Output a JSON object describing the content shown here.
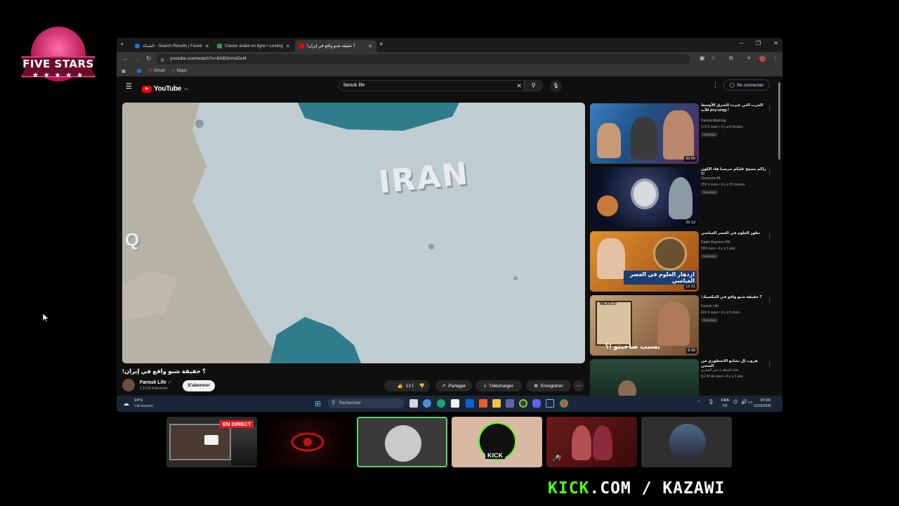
{
  "logo": {
    "text": "FIVE STARS",
    "stars": "★ ★ ★ ★ ★"
  },
  "browser": {
    "tabs": [
      {
        "title": "الشبكة - Search Results | Faceb",
        "favicon_color": "#1877f2"
      },
      {
        "title": "Clavier arabe en ligne • Lexilog",
        "favicon_color": "#2e8b57"
      },
      {
        "title": "!؟ حقيقة شنو واقع في إيران",
        "favicon_color": "#ff0000"
      }
    ],
    "url": "youtube.com/watch?v=8AB3nVwDol4",
    "bookmarks": [
      "Gmail",
      "Maps"
    ]
  },
  "youtube": {
    "search_query": "farouk life",
    "sign_in": "Se connecter",
    "video": {
      "overlay_text": "IRAN",
      "title": "!؟ حقيقة شنو واقع في إيران",
      "channel": "Farouk Life",
      "subscribers": "2,12 M d'abonnés",
      "subscribe": "S'abonner",
      "likes": "12 k",
      "share": "Partager",
      "download": "Télécharger",
      "save": "Enregistrer"
    },
    "recommendations": [
      {
        "title": "الحرب التي غيرت الشرق الأوسط للأبد pcy.uzqg !",
        "channel": "Hamza Abdrzaq",
        "meta": "173 k vues • il y a 6 heures",
        "badge": "Nouveau",
        "duration": "33:09"
      },
      {
        "title": "راكم يسمح عليكم تبرسيا هاد الكون !؟",
        "channel": "Oussama BL",
        "meta": "255 k vues • il y a 15 heures",
        "badge": "Nouveau",
        "duration": "25:13"
      },
      {
        "title": "تطور العلوم في العصر العباسي",
        "channel": "Radio Express FM",
        "meta": "509 vues • il y a 1 jour",
        "badge": "Nouveau",
        "duration": "12:21",
        "thumb_text": "ازدهار العلوم في العصر العباسي"
      },
      {
        "title": "!؟ حقيقة شنو واقع في المكسيك",
        "channel": "Farouk Life",
        "meta": "432 k vues • il y a 5 jours",
        "badge": "Nouveau",
        "duration": "8:28",
        "thumb_text": "بسبب صاحبتو !؟",
        "thumb_label": "MEXICO"
      },
      {
        "title": "هروب إل تشابو الأسطوري من السجن",
        "channel": "قناة الساهد | عمر البخاري",
        "meta": "8,2 M de vues • il y a 2 ans",
        "badge": "",
        "duration": ""
      }
    ]
  },
  "taskbar": {
    "weather_temp": "14°C",
    "weather_desc": "Ciel couvert",
    "search_placeholder": "Rechercher",
    "lang": "FRA",
    "lang_sub": "FR",
    "time": "07:29",
    "date": "01/03/2026"
  },
  "stream": {
    "live_badge": "EN DIRECT",
    "kick_logo": "KICK",
    "footer_brand": "KICK",
    "footer_rest": ".COM / KAZAWI"
  }
}
